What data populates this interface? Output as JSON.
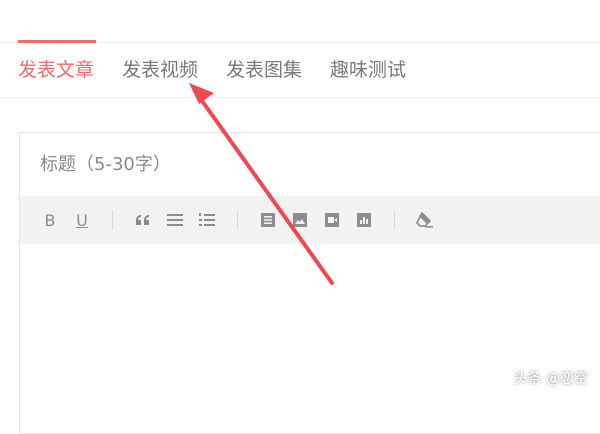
{
  "tabs": [
    {
      "label": "发表文章",
      "active": true
    },
    {
      "label": "发表视频",
      "active": false
    },
    {
      "label": "发表图集",
      "active": false
    },
    {
      "label": "趣味测试",
      "active": false
    }
  ],
  "editor": {
    "title_placeholder": "标题（5-30字）",
    "title_value": ""
  },
  "toolbar": {
    "bold": "B",
    "underline": "U"
  },
  "watermark": "头条 @恋空",
  "colors": {
    "accent": "#f06a6a",
    "arrow": "#f0484e",
    "toolbar_bg": "#f2f2f2"
  }
}
